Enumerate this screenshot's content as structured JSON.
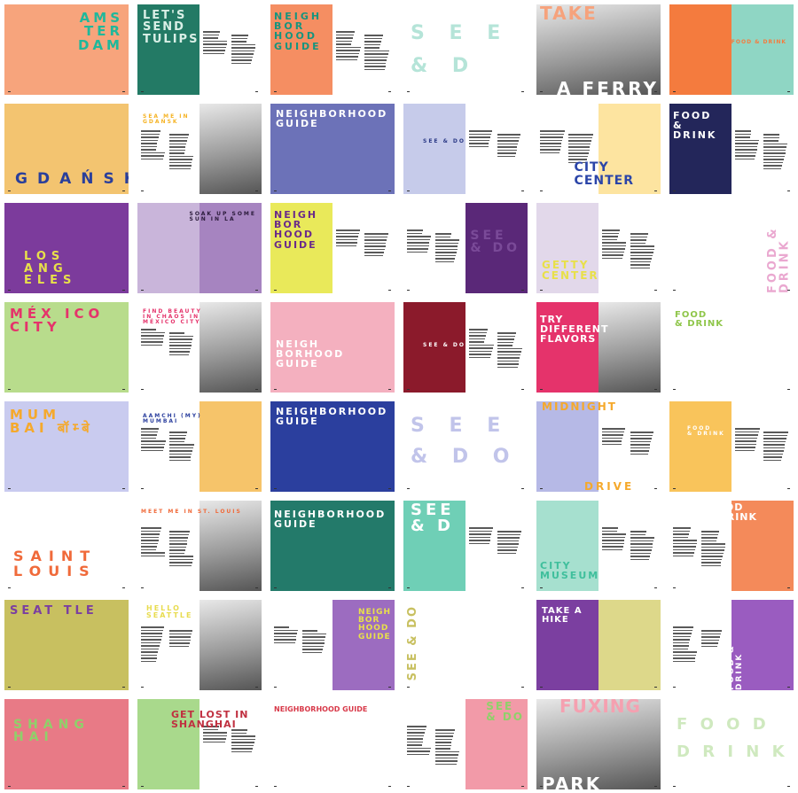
{
  "rows": [
    {
      "city": "Amsterdam",
      "spreads": [
        {
          "title": "AMS\nTER\nDAM",
          "left": "#f7a47c",
          "right": "#f7a47c",
          "title_color": "#1fb89b"
        },
        {
          "title": "LET'S\nSEND\nTULIPS",
          "left": "#237a65",
          "right": "#ffffff",
          "title_color": "#d9efe6"
        },
        {
          "title": "NEIGH\nBOR\nHOOD\nGUIDE",
          "left": "#f58e62",
          "right": "#ffffff",
          "title_color": "#16947e"
        },
        {
          "title": "S  E  E\n&  D",
          "left": "#ffffff",
          "right": "#ffffff",
          "title_color": "#b5e4d8"
        },
        {
          "title": "TAKE",
          "subtitle": "A FERRY",
          "left": "gray",
          "right": "gray",
          "title_color": "#f6a27c",
          "subtitle_color": "#ffffff"
        },
        {
          "title": "FOOD & DRINK",
          "left": "#f47b3e",
          "right": "#8fd6c4",
          "title_color": "#f47b3e"
        }
      ]
    },
    {
      "city": "Gdańsk",
      "spreads": [
        {
          "title": "GDAŃSK",
          "left": "#f3c470",
          "right": "#f3c470",
          "title_color": "#2a3f9b"
        },
        {
          "title": "SEA ME IN\nGDAŃSK",
          "left": "#ffffff",
          "right": "gray",
          "title_color": "#f5b324"
        },
        {
          "title": "NEIGHBORHOOD\nGUIDE",
          "left": "#6c72b8",
          "right": "#6c72b8",
          "title_color": "#ffffff"
        },
        {
          "title": "SEE & DO",
          "left": "#c6cbea",
          "right": "#ffffff",
          "title_color": "#2b3a86"
        },
        {
          "title": "CITY\nCENTER",
          "left": "#ffffff",
          "right": "#fde4a0",
          "title_color": "#2b45a8"
        },
        {
          "title": "FOOD\n&\nDRINK",
          "left": "#23265a",
          "right": "#ffffff",
          "title_color": "#ffffff"
        }
      ]
    },
    {
      "city": "Los Angeles",
      "spreads": [
        {
          "title": "LOS\nANG ELES",
          "left": "#7c3b9c",
          "right": "#7c3b9c",
          "title_color": "#e8e04a"
        },
        {
          "title": "SOAK UP SOME\nSUN IN LA",
          "left": "#c9b5da",
          "right": "#a684c0",
          "title_color": "#2a1a3a"
        },
        {
          "title": "NEIGH\nBOR\nHOOD\nGUIDE",
          "left": "#e9e95a",
          "right": "#ffffff",
          "title_color": "#6a2a8a"
        },
        {
          "title": "SEE\n& DO",
          "left": "#ffffff",
          "right": "#5a2878",
          "title_color": "#7a4a98"
        },
        {
          "title": "GETTY\nCENTER",
          "left": "#e2d8ea",
          "right": "#ffffff",
          "title_color": "#e8e04a"
        },
        {
          "title": "FOOD & DRINK",
          "left": "#ffffff",
          "right": "#ffffff",
          "title_color": "#eaa8d0"
        }
      ]
    },
    {
      "city": "México City",
      "spreads": [
        {
          "title": "MÉX  ICO\nCITY",
          "left": "#b8dc8c",
          "right": "#b8dc8c",
          "title_color": "#e5336b"
        },
        {
          "title": "FIND BEAUTY\nIN CHAOS IN\nMÉXICO CITY",
          "left": "#ffffff",
          "right": "gray",
          "title_color": "#e5336b"
        },
        {
          "title": "NEIGH\nBORHOOD\nGUIDE",
          "left": "#f4b0bf",
          "right": "#f4b0bf",
          "title_color": "#ffffff"
        },
        {
          "title": "SEE & DO",
          "left": "#8b1a2b",
          "right": "#ffffff",
          "title_color": "#ffffff"
        },
        {
          "title": "TRY\nDIFFERENT\nFLAVORS",
          "left": "#e5336b",
          "right": "gray",
          "title_color": "#ffffff"
        },
        {
          "title": "FOOD\n& DRINK",
          "left": "#ffffff",
          "right": "#ffffff",
          "title_color": "#8fc64a"
        }
      ]
    },
    {
      "city": "Mumbai",
      "spreads": [
        {
          "title": "MUM\nBAI  बॉम्बे",
          "left": "#c9cbef",
          "right": "#c9cbef",
          "title_color": "#f5a92c"
        },
        {
          "title": "AAMCHI (MY)\nMUMBAI",
          "left": "#ffffff",
          "right": "#f6c46a",
          "title_color": "#2b3f9e"
        },
        {
          "title": "NEIGHBORHOOD\nGUIDE",
          "left": "#2b3f9e",
          "right": "#2b3f9e",
          "title_color": "#ffffff"
        },
        {
          "title": "S  E  E\n&  D  O",
          "left": "#ffffff",
          "right": "#ffffff",
          "title_color": "#c1c4ea"
        },
        {
          "title": "MIDNIGHT",
          "subtitle": "DRIVE",
          "left": "#b6b9e6",
          "right": "#ffffff",
          "title_color": "#f5a92c",
          "subtitle_color": "#f5a92c"
        },
        {
          "title": "FOOD\n& DRINK",
          "left": "#f9c45b",
          "right": "#ffffff",
          "title_color": "#ffffff"
        }
      ]
    },
    {
      "city": "Saint Louis",
      "spreads": [
        {
          "title": "SAINT\nLOUIS",
          "left": "#ffffff",
          "right": "#ffffff",
          "title_color": "#f06a3a"
        },
        {
          "title": "MEET ME IN ST.   LOUIS",
          "left": "#ffffff",
          "right": "gray",
          "title_color": "#f06a3a"
        },
        {
          "title": "NEIGHBORHOOD\nGUIDE",
          "left": "#237a6a",
          "right": "#237a6a",
          "title_color": "#ffffff"
        },
        {
          "title": "SEE\n&    D",
          "left": "#6fcfb6",
          "right": "#ffffff",
          "title_color": "#ffffff"
        },
        {
          "title": "CITY\nMUSEUM",
          "left": "#a6e0cf",
          "right": "#ffffff",
          "title_color": "#3fbf9c"
        },
        {
          "title": "FOOD  &DRINK",
          "left": "#ffffff",
          "right": "#f48a5a",
          "title_color": "#ffffff"
        }
      ]
    },
    {
      "city": "Seattle",
      "spreads": [
        {
          "title": "SEAT TLE",
          "left": "#c8c060",
          "right": "#c8c060",
          "title_color": "#7b3fa0"
        },
        {
          "title": "HELLO\nSEATTLE",
          "left": "#ffffff",
          "right": "gray",
          "title_color": "#e8dc50"
        },
        {
          "title": "NEIGH\nBOR\nHOOD\nGUIDE",
          "left": "#ffffff",
          "right": "#9c6cc0",
          "title_color": "#e8e04a"
        },
        {
          "title": "SEE & DO",
          "left": "#ffffff",
          "right": "#ffffff",
          "title_color": "#c8c060"
        },
        {
          "title": "TAKE A\nHIKE",
          "left": "#7b3fa0",
          "right": "#ddd88a",
          "title_color": "#ffffff"
        },
        {
          "title": "FOOD & DRINK",
          "left": "#ffffff",
          "right": "#9a5cc0",
          "title_color": "#ffffff"
        }
      ]
    },
    {
      "city": "Shanghai",
      "spreads": [
        {
          "title": "SHANG\nHAI",
          "left": "#e87a86",
          "right": "#e87a86",
          "title_color": "#8fd06a"
        },
        {
          "title": "GET LOST IN\nSHANGHAI",
          "left": "#a9d98c",
          "right": "#ffffff",
          "title_color": "#c03040"
        },
        {
          "title": "NEIGHBORHOOD GUIDE",
          "left": "#ffffff",
          "right": "#ffffff",
          "title_color": "#d83a4a"
        },
        {
          "title": "SEE\n& DO",
          "left": "#ffffff",
          "right": "#f29aa8",
          "title_color": "#8fd06a"
        },
        {
          "title": "FUXING",
          "subtitle": "PARK",
          "left": "gray",
          "right": "gray",
          "title_color": "#f5a0b0",
          "subtitle_color": "#ffffff"
        },
        {
          "title": "F  O  O  D\nD  R  I  N  K",
          "left": "#ffffff",
          "right": "#ffffff",
          "title_color": "#cfe9bf"
        }
      ]
    }
  ]
}
